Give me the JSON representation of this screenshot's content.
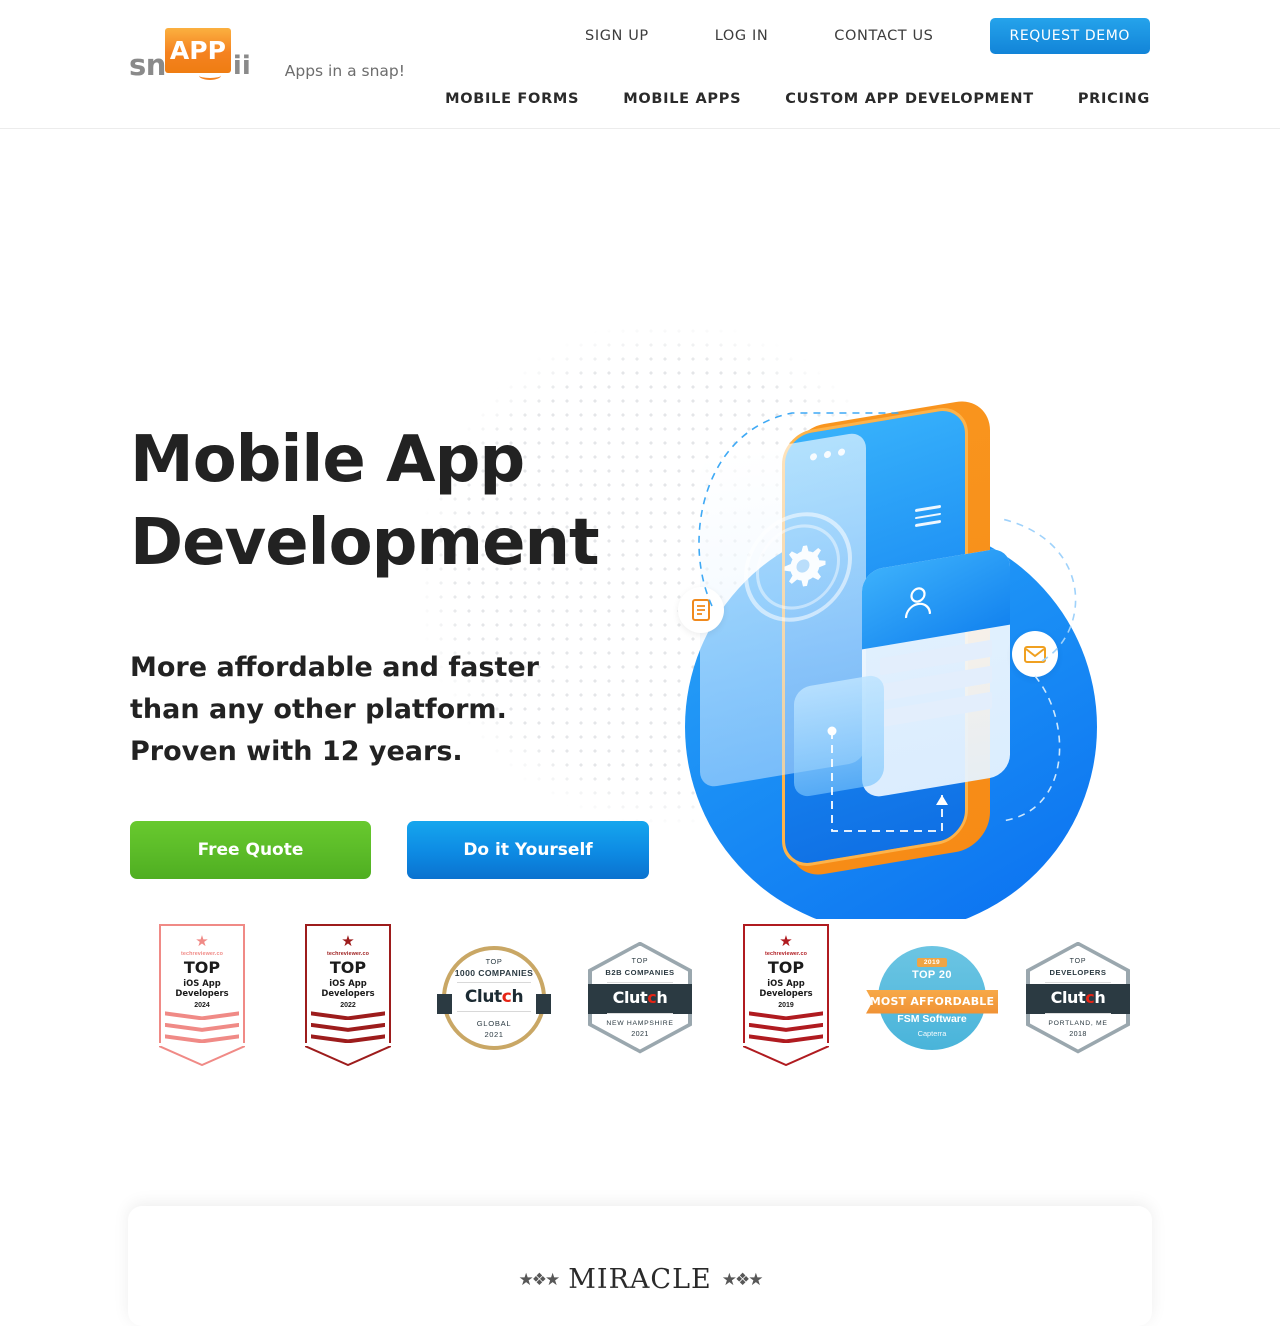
{
  "header": {
    "logo": {
      "part1": "sn",
      "part2": "APP",
      "part3": "ii"
    },
    "tagline": "Apps in a snap!",
    "top_links": [
      {
        "label": "SIGN UP"
      },
      {
        "label": "LOG IN"
      },
      {
        "label": "CONTACT US"
      }
    ],
    "demo_button": "REQUEST DEMO",
    "main_nav": [
      {
        "label": "MOBILE FORMS"
      },
      {
        "label": "MOBILE APPS"
      },
      {
        "label": "CUSTOM APP DEVELOPMENT"
      },
      {
        "label": "PRICING"
      }
    ]
  },
  "hero": {
    "title_line1": "Mobile App",
    "title_line2": "Development",
    "subtitle_line1": "More affordable and faster",
    "subtitle_line2": "than any other platform.",
    "subtitle_line3": "Proven with 12 years.",
    "primary_button": "Free Quote",
    "secondary_button": "Do it Yourself",
    "illustration_icons": {
      "document": "document-icon",
      "mail": "mail-icon",
      "gear": "gear-icon",
      "person": "person-icon"
    }
  },
  "badges": [
    {
      "type": "techreviewer-shield",
      "brand": "techreviewer.co",
      "top": "TOP",
      "category_line1": "iOS App",
      "category_line2": "Developers",
      "year": "2024",
      "color": "#f08a86"
    },
    {
      "type": "techreviewer-shield",
      "brand": "techreviewer.co",
      "top": "TOP",
      "category_line1": "iOS App",
      "category_line2": "Developers",
      "year": "2022",
      "color": "#9d1c1c"
    },
    {
      "type": "clutch-circle",
      "top": "TOP",
      "category": "1000 COMPANIES",
      "logo": "Clutch",
      "location": "GLOBAL",
      "year": "2021",
      "color": "#c9a765"
    },
    {
      "type": "clutch-hex",
      "top": "TOP",
      "category": "B2B COMPANIES",
      "logo": "Clutch",
      "location": "NEW HAMPSHIRE",
      "year": "2021",
      "color": "#9aa7ae"
    },
    {
      "type": "techreviewer-shield",
      "brand": "techreviewer.co",
      "top": "TOP",
      "category_line1": "iOS App",
      "category_line2": "Developers",
      "year": "2019",
      "color": "#b01b20"
    },
    {
      "type": "capterra",
      "year": "2019",
      "top": "TOP 20",
      "ribbon": "MOST AFFORDABLE",
      "category": "FSM Software",
      "brand": "Capterra",
      "color": "#49b4da"
    },
    {
      "type": "clutch-hex",
      "top": "TOP",
      "category": "DEVELOPERS",
      "logo": "Clutch",
      "location": "PORTLAND, ME",
      "year": "2018",
      "color": "#9aa7ae"
    }
  ],
  "bottom_card": {
    "logo_text": "MIRACLE"
  },
  "colors": {
    "accent_blue": "#1284d8",
    "accent_green": "#5bbb28",
    "accent_orange": "#f58220",
    "text_dark": "#222222"
  }
}
